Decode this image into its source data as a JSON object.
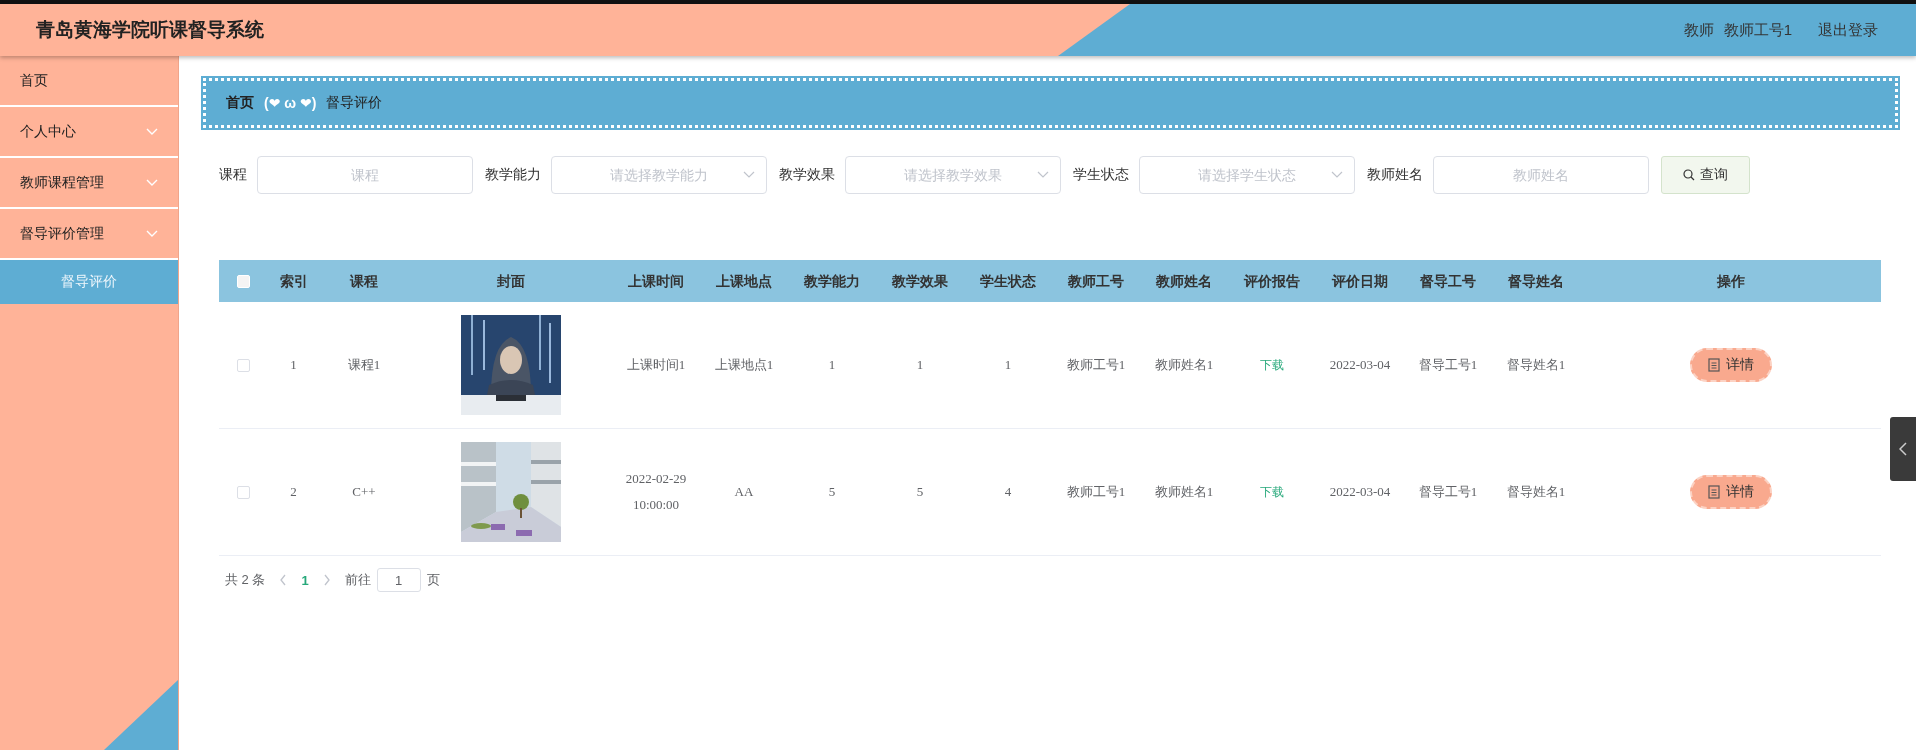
{
  "header": {
    "title": "青岛黄海学院听课督导系统",
    "role": "教师",
    "user": "教师工号1",
    "logout": "退出登录"
  },
  "sidebar": {
    "items": [
      {
        "label": "首页",
        "kind": "link"
      },
      {
        "label": "个人中心",
        "kind": "submenu"
      },
      {
        "label": "教师课程管理",
        "kind": "submenu"
      },
      {
        "label": "督导评价管理",
        "kind": "submenu",
        "children": [
          {
            "label": "督导评价",
            "selected": true
          }
        ]
      }
    ]
  },
  "breadcrumb": {
    "home": "首页",
    "separator": "(❤ ω ❤)",
    "current": "督导评价"
  },
  "filters": [
    {
      "label": "课程",
      "kind": "input",
      "placeholder": "课程"
    },
    {
      "label": "教学能力",
      "kind": "select",
      "placeholder": "请选择教学能力"
    },
    {
      "label": "教学效果",
      "kind": "select",
      "placeholder": "请选择教学效果"
    },
    {
      "label": "学生状态",
      "kind": "select",
      "placeholder": "请选择学生状态"
    },
    {
      "label": "教师姓名",
      "kind": "input",
      "placeholder": "教师姓名"
    }
  ],
  "search_button": "查询",
  "table": {
    "select_all_checked": false,
    "columns": [
      "索引",
      "课程",
      "封面",
      "上课时间",
      "上课地点",
      "教学能力",
      "教学效果",
      "学生状态",
      "教师工号",
      "教师姓名",
      "评价报告",
      "评价日期",
      "督导工号",
      "督导姓名",
      "操作"
    ],
    "rows": [
      {
        "checked": false,
        "index": "1",
        "course": "课程1",
        "time": "上课时间1",
        "place": "上课地点1",
        "ability": "1",
        "effect": "1",
        "status": "1",
        "teacher_no": "教师工号1",
        "teacher_name": "教师姓名1",
        "report": "下载",
        "date": "2022-03-04",
        "supervisor_no": "督导工号1",
        "supervisor_name": "督导姓名1",
        "action": "详情"
      },
      {
        "checked": false,
        "index": "2",
        "course": "C++",
        "time": "2022-02-29 10:00:00",
        "place": "AA",
        "ability": "5",
        "effect": "5",
        "status": "4",
        "teacher_no": "教师工号1",
        "teacher_name": "教师姓名1",
        "report": "下载",
        "date": "2022-03-04",
        "supervisor_no": "督导工号1",
        "supervisor_name": "督导姓名1",
        "action": "详情"
      }
    ]
  },
  "pagination": {
    "total": "共 2 条",
    "pages": [
      {
        "label": "1",
        "selected": true
      }
    ],
    "goto_label": "前往",
    "goto_value": "1",
    "page_suffix": "页"
  }
}
